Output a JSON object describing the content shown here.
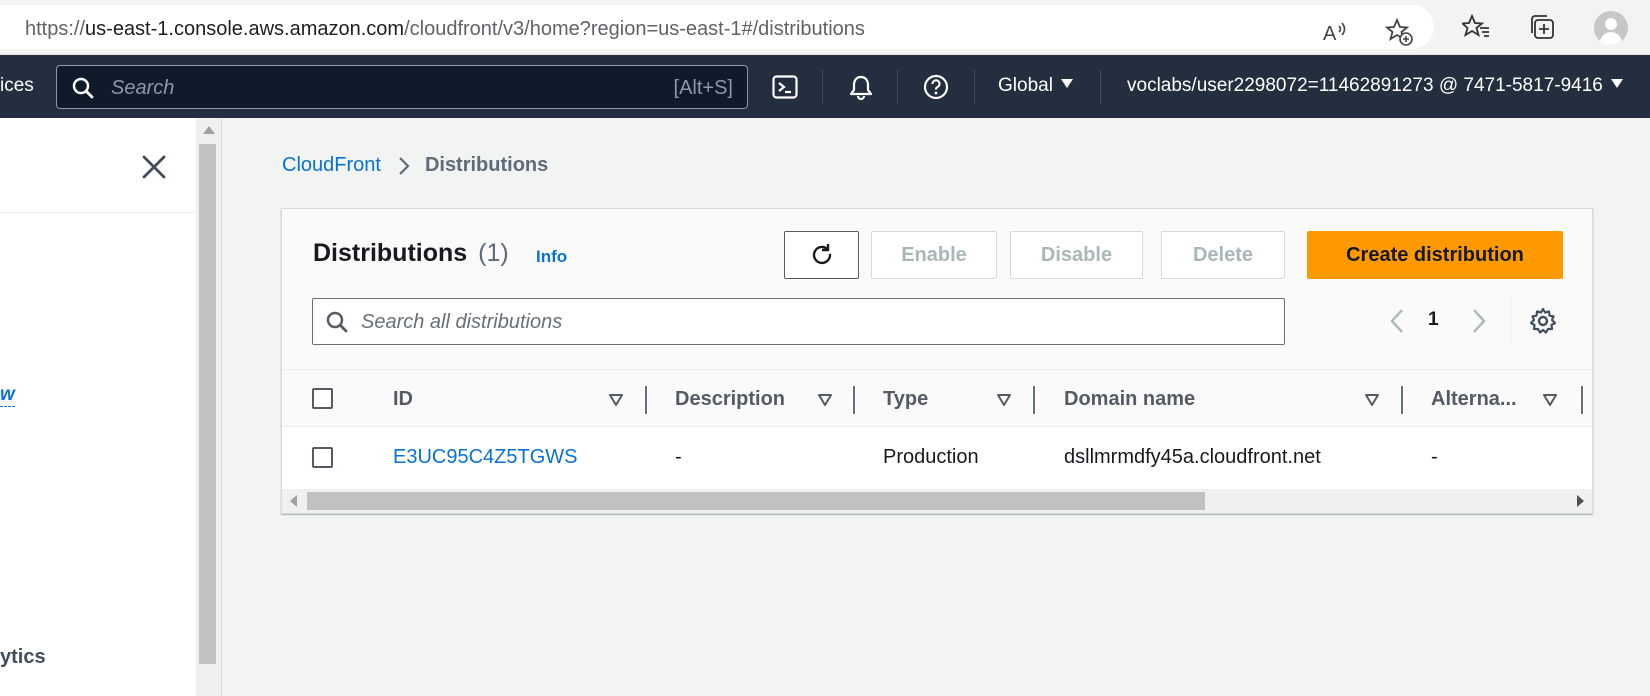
{
  "browser": {
    "url_prefix": "https://",
    "url_host": "us-east-1.console.aws.amazon.com",
    "url_path": "/cloudfront/v3/home?region=us-east-1#/distributions",
    "icons": [
      "read-aloud-icon",
      "add-favorite-icon",
      "favorites-icon",
      "collections-icon",
      "profile-avatar"
    ]
  },
  "awsnav": {
    "services_label": "ices",
    "search_placeholder": "Search",
    "search_shortcut": "[Alt+S]",
    "region": "Global",
    "account": "voclabs/user2298072=11462891273 @ 7471-5817-9416",
    "bg_color": "#232f3e"
  },
  "sidepanel": {
    "partial_link": "w",
    "partial_item": "ytics"
  },
  "breadcrumb": {
    "root": "CloudFront",
    "current": "Distributions"
  },
  "card": {
    "title": "Distributions",
    "count": "(1)",
    "info": "Info",
    "buttons": {
      "enable": "Enable",
      "disable": "Disable",
      "delete": "Delete",
      "create": "Create distribution"
    },
    "filter_placeholder": "Search all distributions",
    "page": "1",
    "accent_color": "#ff9900"
  },
  "table": {
    "columns": [
      "ID",
      "Description",
      "Type",
      "Domain name",
      "Alterna..."
    ],
    "rows": [
      {
        "id": "E3UC95C4Z5TGWS",
        "description": "-",
        "type": "Production",
        "domain": "dsllmrmdfy45a.cloudfront.net",
        "alternate": "-"
      }
    ]
  }
}
